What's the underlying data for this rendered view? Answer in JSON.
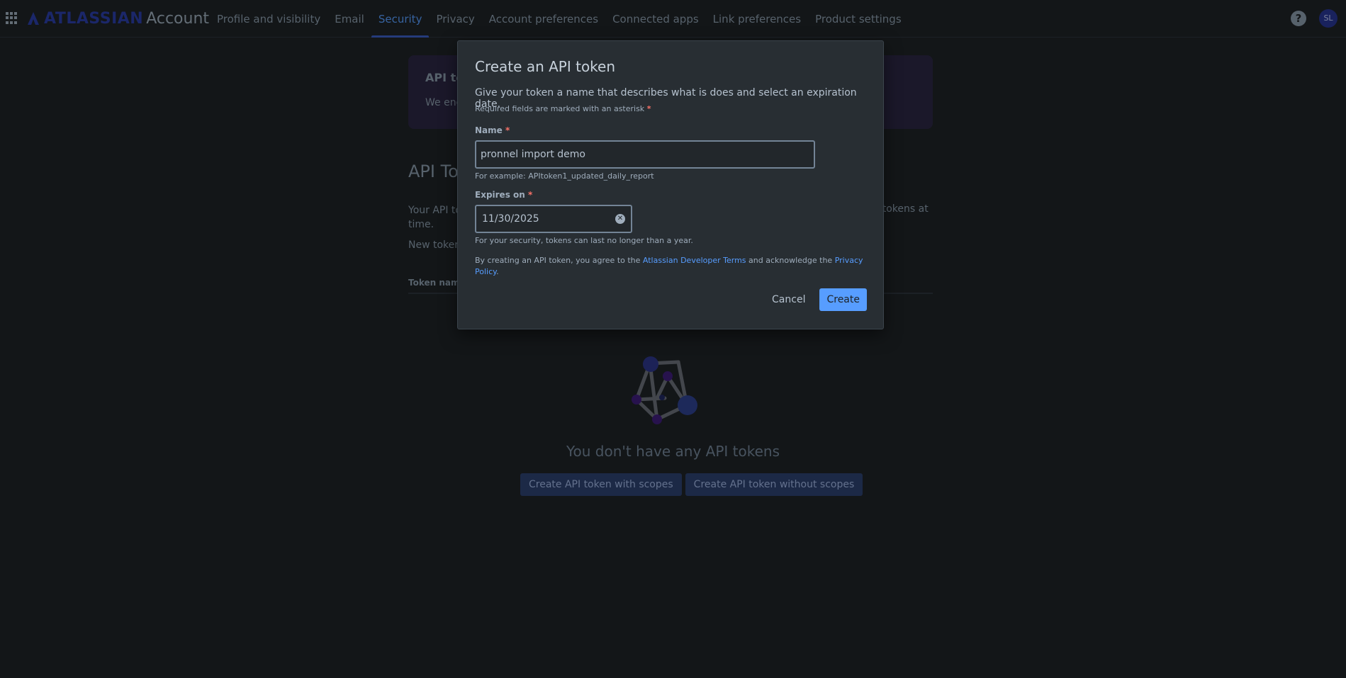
{
  "header": {
    "brand": "ATLASSIAN",
    "product": "Account",
    "nav": [
      {
        "label": "Profile and visibility"
      },
      {
        "label": "Email"
      },
      {
        "label": "Security",
        "active": true
      },
      {
        "label": "Privacy"
      },
      {
        "label": "Account preferences"
      },
      {
        "label": "Connected apps"
      },
      {
        "label": "Link preferences"
      },
      {
        "label": "Product settings"
      }
    ],
    "help_icon": "?",
    "avatar_initials": "SL"
  },
  "background": {
    "notice_title": "API to",
    "notice_text": "We enc",
    "section_title": "API To",
    "desc_left": "Your API to a time.",
    "desc_right": "s tokens at",
    "desc_new": "New token",
    "table_header": "Token name",
    "empty_text": "You don't have any API tokens",
    "btn_with_scopes": "Create API token with scopes",
    "btn_without_scopes": "Create API token without scopes"
  },
  "modal": {
    "title": "Create an API token",
    "description": "Give your token a name that describes what is does and select an expiration date.",
    "required_note": "Required fields are marked with an asterisk",
    "asterisk": "*",
    "name_label": "Name",
    "name_value": "pronnel import demo",
    "name_help": "For example: APItoken1_updated_daily_report",
    "expires_label": "Expires on",
    "expires_value": "11/30/2025",
    "expires_help": "For your security, tokens can last no longer than a year.",
    "terms_prefix": "By creating an API token, you agree to the ",
    "terms_link1": "Atlassian Developer Terms",
    "terms_middle": " and acknowledge the ",
    "terms_link2": "Privacy Policy",
    "terms_suffix": ".",
    "cancel_label": "Cancel",
    "create_label": "Create"
  },
  "colors": {
    "accent": "#579dff",
    "background": "#1d2125",
    "modal": "#282e33",
    "required": "#f87168"
  }
}
